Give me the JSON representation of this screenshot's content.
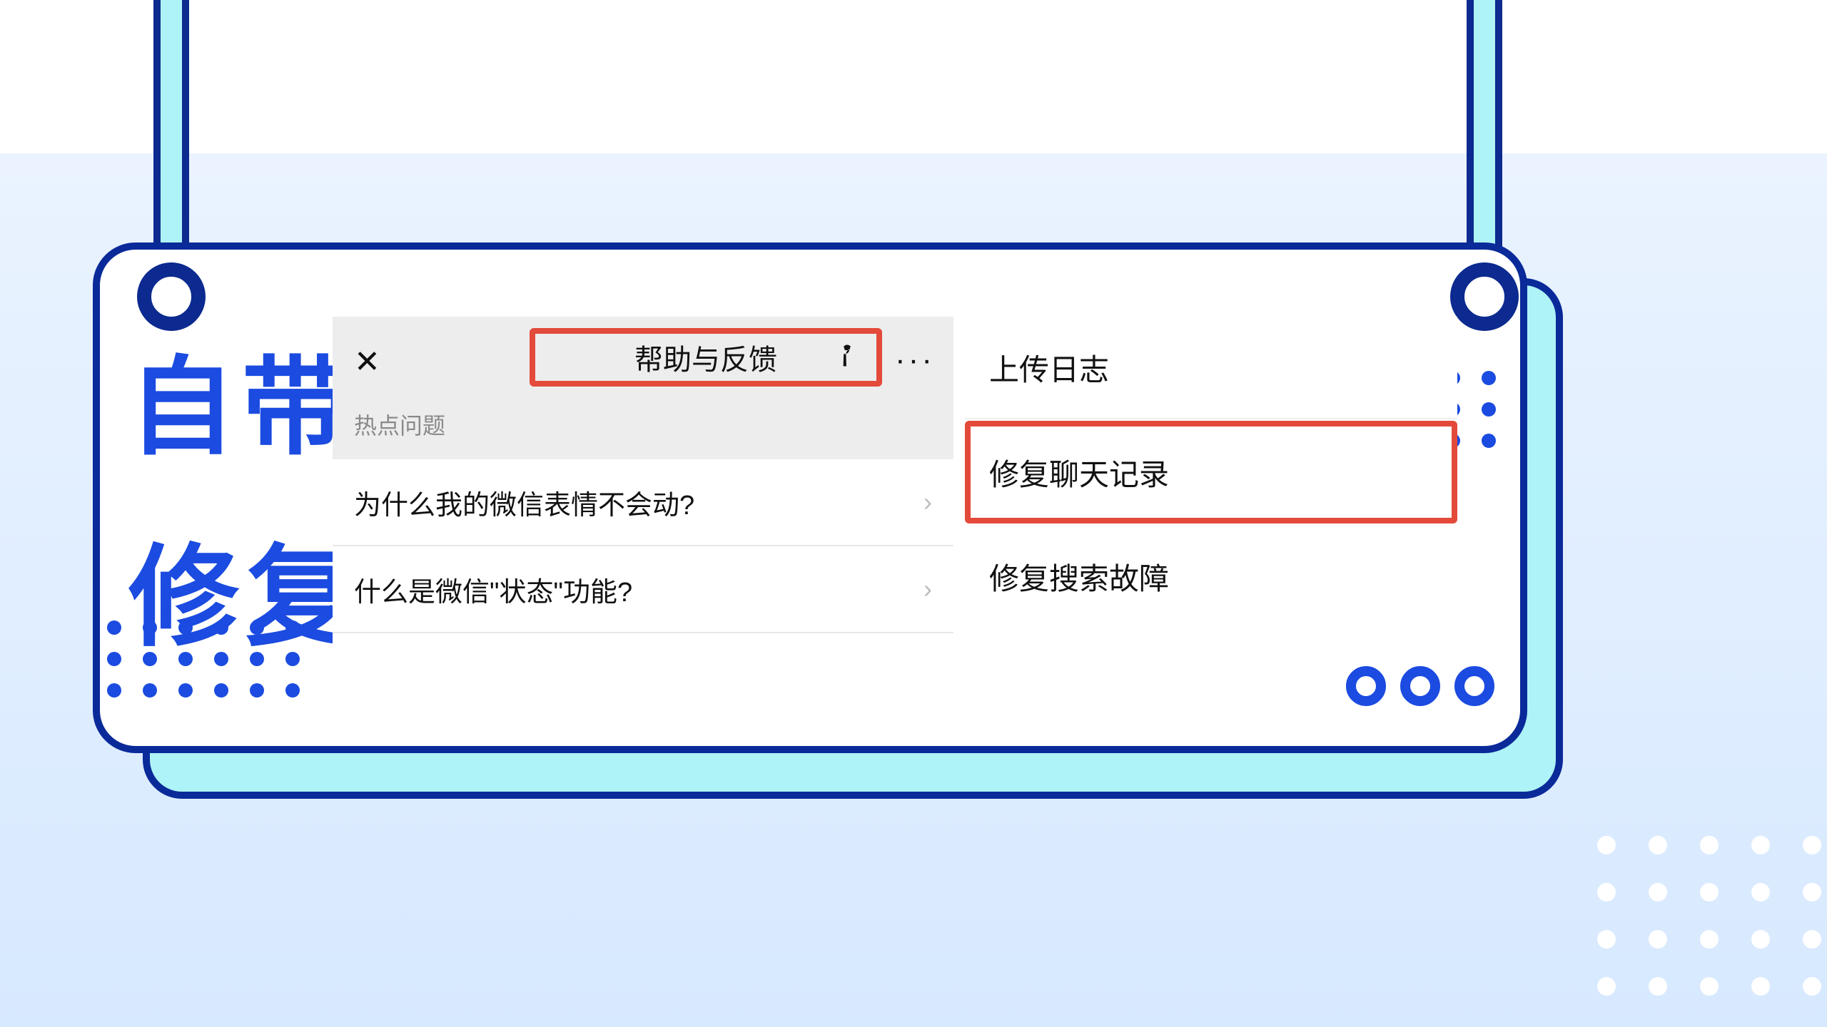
{
  "title": {
    "line1": "自带",
    "line2": "修复"
  },
  "panel1": {
    "header_title": "帮助与反馈",
    "subhead": "热点问题",
    "items": [
      "为什么我的微信表情不会动?",
      "什么是微信\"状态\"功能?"
    ]
  },
  "panel2": {
    "items": [
      "上传日志",
      "修复聊天记录",
      "修复搜索故障"
    ]
  }
}
